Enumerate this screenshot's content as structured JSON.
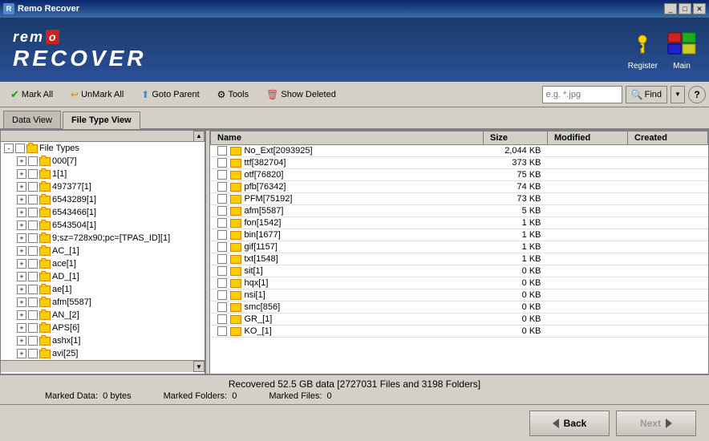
{
  "window": {
    "title": "Remo Recover"
  },
  "titlebar": {
    "controls": [
      "_",
      "□",
      "✕"
    ]
  },
  "header": {
    "logo_remo": "remo",
    "logo_box": "o",
    "logo_recover": "RECOVER",
    "register_label": "Register",
    "main_label": "Main"
  },
  "toolbar": {
    "mark_all": "Mark All",
    "unmark_all": "UnMark All",
    "goto_parent": "Goto Parent",
    "tools": "Tools",
    "show_deleted": "Show Deleted",
    "search_placeholder": "e.g. *.jpg",
    "find": "Find",
    "help": "?"
  },
  "tabs": [
    {
      "id": "data-view",
      "label": "Data View",
      "active": false
    },
    {
      "id": "file-type-view",
      "label": "File Type View",
      "active": true
    }
  ],
  "tree": {
    "header": "File Types",
    "items": [
      {
        "indent": 2,
        "name": "000[7]"
      },
      {
        "indent": 2,
        "name": "1[1]"
      },
      {
        "indent": 2,
        "name": "497377[1]"
      },
      {
        "indent": 2,
        "name": "6543289[1]"
      },
      {
        "indent": 2,
        "name": "6543466[1]"
      },
      {
        "indent": 2,
        "name": "6543504[1]"
      },
      {
        "indent": 2,
        "name": "9;sz=728x90;pc=[TPAS_ID][1]"
      },
      {
        "indent": 2,
        "name": "AC_[1]"
      },
      {
        "indent": 2,
        "name": "ace[1]"
      },
      {
        "indent": 2,
        "name": "AD_[1]"
      },
      {
        "indent": 2,
        "name": "ae[1]"
      },
      {
        "indent": 2,
        "name": "afm[5587]"
      },
      {
        "indent": 2,
        "name": "AN_[2]"
      },
      {
        "indent": 2,
        "name": "APS[6]"
      },
      {
        "indent": 2,
        "name": "ashx[1]"
      },
      {
        "indent": 2,
        "name": "avi[25]"
      }
    ]
  },
  "files": {
    "columns": [
      "Name",
      "Size",
      "Modified",
      "Created"
    ],
    "rows": [
      {
        "name": "No_Ext[2093925]",
        "size": "2,044 KB",
        "modified": "",
        "created": ""
      },
      {
        "name": "ttf[382704]",
        "size": "373 KB",
        "modified": "",
        "created": ""
      },
      {
        "name": "otf[76820]",
        "size": "75 KB",
        "modified": "",
        "created": ""
      },
      {
        "name": "pfb[76342]",
        "size": "74 KB",
        "modified": "",
        "created": ""
      },
      {
        "name": "PFM[75192]",
        "size": "73 KB",
        "modified": "",
        "created": ""
      },
      {
        "name": "afm[5587]",
        "size": "5 KB",
        "modified": "",
        "created": ""
      },
      {
        "name": "fon[1542]",
        "size": "1 KB",
        "modified": "",
        "created": ""
      },
      {
        "name": "bin[1677]",
        "size": "1 KB",
        "modified": "",
        "created": ""
      },
      {
        "name": "gif[1157]",
        "size": "1 KB",
        "modified": "",
        "created": ""
      },
      {
        "name": "txt[1548]",
        "size": "1 KB",
        "modified": "",
        "created": ""
      },
      {
        "name": "sit[1]",
        "size": "0 KB",
        "modified": "",
        "created": ""
      },
      {
        "name": "hqx[1]",
        "size": "0 KB",
        "modified": "",
        "created": ""
      },
      {
        "name": "nsi[1]",
        "size": "0 KB",
        "modified": "",
        "created": ""
      },
      {
        "name": "smc[856]",
        "size": "0 KB",
        "modified": "",
        "created": ""
      },
      {
        "name": "GR_[1]",
        "size": "0 KB",
        "modified": "",
        "created": ""
      },
      {
        "name": "KO_[1]",
        "size": "0 KB",
        "modified": "",
        "created": ""
      }
    ]
  },
  "statusbar": {
    "recovered": "Recovered 52.5 GB data [2727031 Files and 3198 Folders]",
    "marked_data_label": "Marked Data:",
    "marked_data_value": "0 bytes",
    "marked_folders_label": "Marked Folders:",
    "marked_folders_value": "0",
    "marked_files_label": "Marked Files:",
    "marked_files_value": "0"
  },
  "buttons": {
    "back": "Back",
    "next": "Next"
  }
}
